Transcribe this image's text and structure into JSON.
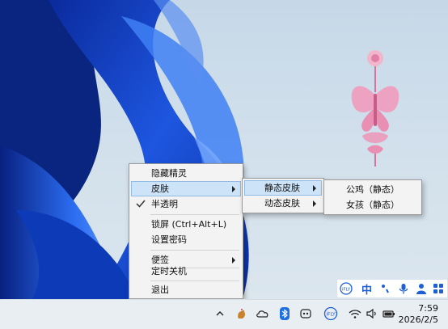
{
  "colors": {
    "accent": "#1f5fd6",
    "menu_bg": "#f3f3f3",
    "highlight": "#cde3f7",
    "sprite_pink": "#e88fb3"
  },
  "context_menu": {
    "items": [
      {
        "label": "隐藏精灵"
      },
      {
        "label": "皮肤",
        "has_submenu": true,
        "highlighted": true
      },
      {
        "label": "半透明",
        "checked": true
      },
      {
        "label": "锁屏 (Ctrl+Alt+L)"
      },
      {
        "label": "设置密码"
      },
      {
        "label": "便签",
        "has_submenu": true
      },
      {
        "label": "定时关机"
      },
      {
        "label": "退出"
      }
    ]
  },
  "skin_menu": {
    "items": [
      {
        "label": "静态皮肤",
        "has_submenu": true,
        "highlighted": true
      },
      {
        "label": "动态皮肤",
        "has_submenu": true
      }
    ]
  },
  "static_skin_menu": {
    "items": [
      {
        "label": "公鸡（静态）"
      },
      {
        "label": "女孩（静态）"
      }
    ]
  },
  "ime_toolbar": {
    "mode": "中",
    "icons": [
      "iflytek-logo-icon",
      "punctuation-icon",
      "microphone-icon",
      "user-icon",
      "grid-apps-icon"
    ]
  },
  "taskbar": {
    "tray_icons": [
      "chevron-up-icon",
      "rooster-app-icon",
      "cloud-icon",
      "bluetooth-icon",
      "copilot-icon",
      "iflytek-tray-icon",
      "wifi-icon",
      "speaker-icon",
      "battery-icon"
    ],
    "time": "7:59",
    "date": "2026/2/5"
  }
}
